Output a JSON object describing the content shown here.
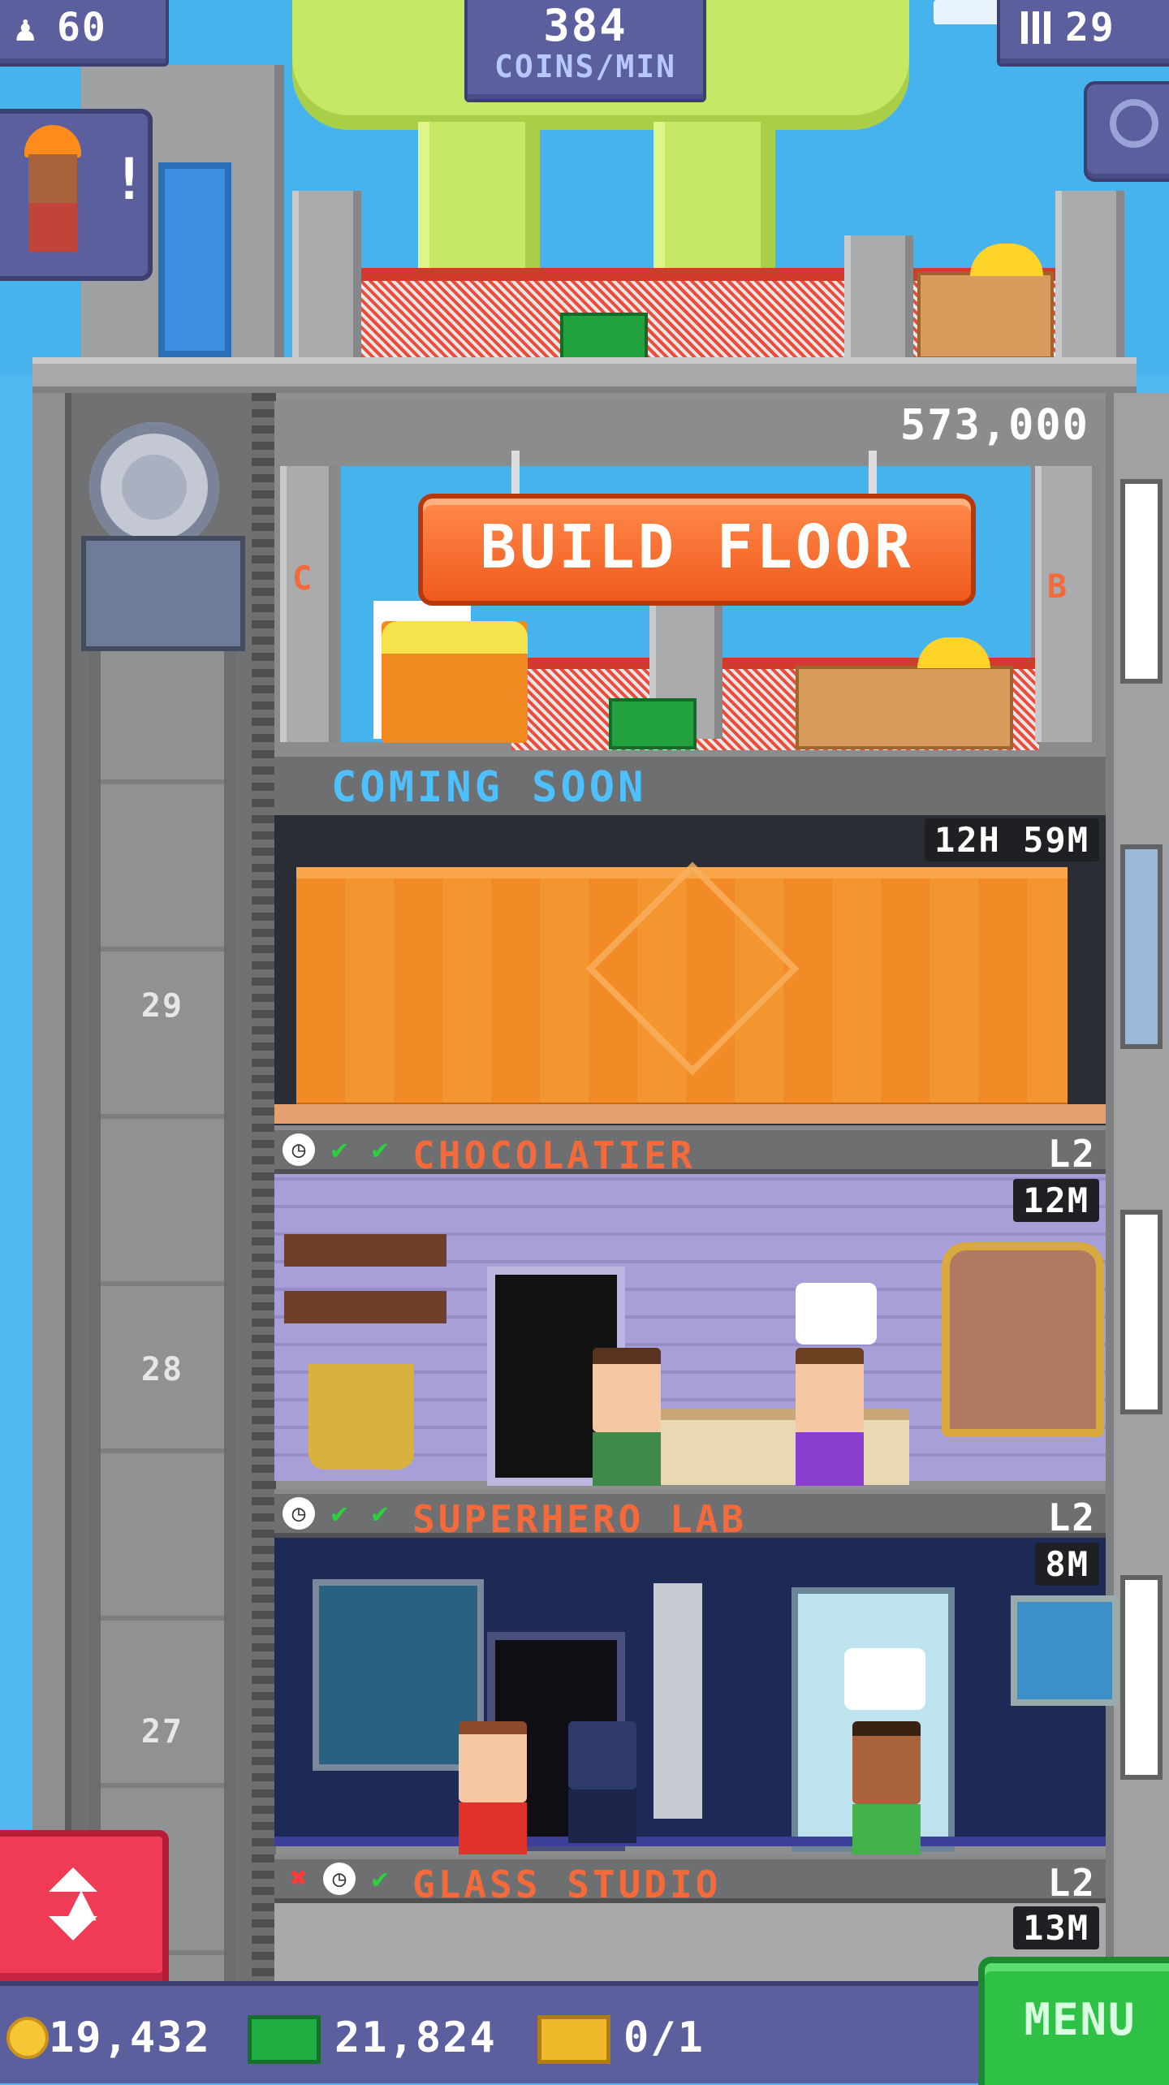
{
  "hud": {
    "residents": "60",
    "coins_per_min_value": "384",
    "coins_per_min_label": "COINS/MIN",
    "floors": "29"
  },
  "build": {
    "price": "573,000",
    "button_label": "BUILD FLOOR",
    "left_marker": "C",
    "right_marker": "B",
    "coming_soon": "COMING SOON"
  },
  "construction": {
    "timer": "12H 59M"
  },
  "floors": [
    {
      "name": "CHOCOLATIER",
      "level": "L2",
      "time": "12M",
      "shaft_number": "29"
    },
    {
      "name": "SUPERHERO LAB",
      "level": "L2",
      "time": "8M",
      "shaft_number": "28"
    },
    {
      "name": "GLASS STUDIO",
      "level": "L2",
      "time": "13M",
      "shaft_number": "27"
    }
  ],
  "bottom_bar": {
    "coins": "19,432",
    "bux": "21,824",
    "tickets": "0/1",
    "menu_label": "MENU"
  },
  "colors": {
    "sky": "#47b3ec",
    "hud": "#5c5f9e",
    "floor_name": "#f46a3a",
    "coming_soon": "#4fc0ff",
    "menu": "#2fc146",
    "elevator_button": "#ef3b55"
  },
  "icons": [
    "resident-icon",
    "floor-count-icon",
    "search-icon",
    "worker-alert-icon",
    "clock-icon",
    "check-icon",
    "cross-icon",
    "coin-icon",
    "bux-icon",
    "ticket-icon",
    "elevator-arrows-icon"
  ]
}
